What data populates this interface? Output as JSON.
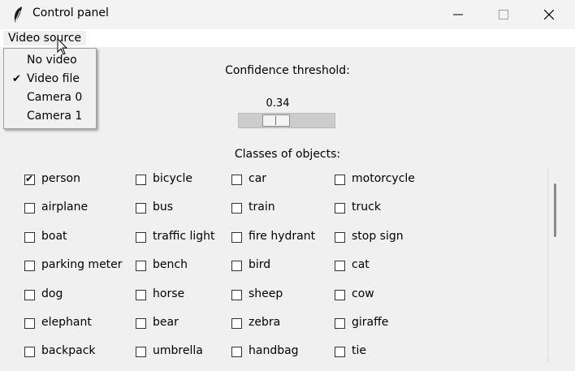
{
  "window": {
    "title": "Control panel"
  },
  "menubar": {
    "video_source": "Video source"
  },
  "dropdown": {
    "items": [
      {
        "label": "No video",
        "checked": false
      },
      {
        "label": "Video file",
        "checked": true
      },
      {
        "label": "Camera 0",
        "checked": false
      },
      {
        "label": "Camera 1",
        "checked": false
      }
    ]
  },
  "confidence": {
    "label": "Confidence threshold:",
    "value": "0.34",
    "fraction": 0.34
  },
  "classes": {
    "label": "Classes of objects:",
    "rows": [
      [
        {
          "label": "person",
          "checked": true
        },
        {
          "label": "bicycle",
          "checked": false
        },
        {
          "label": "car",
          "checked": false
        },
        {
          "label": "motorcycle",
          "checked": false
        }
      ],
      [
        {
          "label": "airplane",
          "checked": false
        },
        {
          "label": "bus",
          "checked": false
        },
        {
          "label": "train",
          "checked": false
        },
        {
          "label": "truck",
          "checked": false
        }
      ],
      [
        {
          "label": "boat",
          "checked": false
        },
        {
          "label": "traffic light",
          "checked": false
        },
        {
          "label": "fire hydrant",
          "checked": false
        },
        {
          "label": "stop sign",
          "checked": false
        }
      ],
      [
        {
          "label": "parking meter",
          "checked": false
        },
        {
          "label": "bench",
          "checked": false
        },
        {
          "label": "bird",
          "checked": false
        },
        {
          "label": "cat",
          "checked": false
        }
      ],
      [
        {
          "label": "dog",
          "checked": false
        },
        {
          "label": "horse",
          "checked": false
        },
        {
          "label": "sheep",
          "checked": false
        },
        {
          "label": "cow",
          "checked": false
        }
      ],
      [
        {
          "label": "elephant",
          "checked": false
        },
        {
          "label": "bear",
          "checked": false
        },
        {
          "label": "zebra",
          "checked": false
        },
        {
          "label": "giraffe",
          "checked": false
        }
      ],
      [
        {
          "label": "backpack",
          "checked": false
        },
        {
          "label": "umbrella",
          "checked": false
        },
        {
          "label": "handbag",
          "checked": false
        },
        {
          "label": "tie",
          "checked": false
        }
      ]
    ]
  },
  "icons": {
    "app": "feather-icon",
    "minimize": "minimize-icon",
    "maximize": "maximize-icon",
    "close": "close-icon",
    "cursor": "mouse-pointer-icon"
  }
}
